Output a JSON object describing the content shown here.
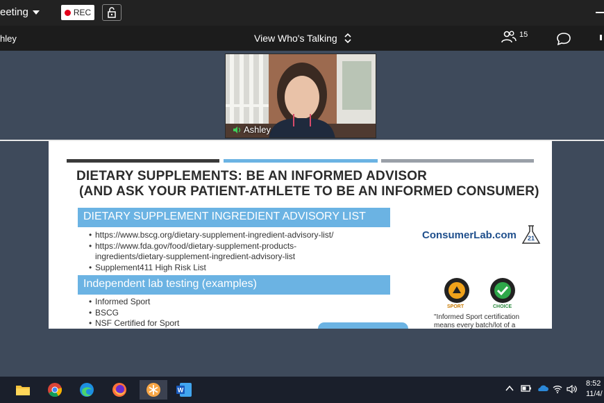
{
  "window": {
    "meeting_menu": "eeting",
    "rec_label": "REC"
  },
  "toolbar": {
    "speaker_name": "hley",
    "view_who_label": "View Who's Talking",
    "participant_count": "15"
  },
  "video": {
    "speaker_label": "Ashley"
  },
  "slide": {
    "title_line1": "DIETARY SUPPLEMENTS: BE AN INFORMED ADVISOR",
    "title_line2": "(AND ASK YOUR PATIENT-ATHLETE TO BE AN INFORMED CONSUMER)",
    "section1": {
      "heading": "DIETARY SUPPLEMENT INGREDIENT ADVISORY LIST",
      "bullets": [
        "https://www.bscg.org/dietary-supplement-ingredient-advisory-list/",
        "https://www.fda.gov/food/dietary-supplement-products-",
        "ingredients/dietary-supplement-ingredient-advisory-list",
        "Supplement411 High Risk List"
      ]
    },
    "section2": {
      "heading": "Independent lab testing (examples)",
      "bullets": [
        "Informed Sport",
        "BSCG",
        "NSF Certified for Sport"
      ]
    },
    "consumerlab_logo": "ConsumerLab.com",
    "years_badge": "21",
    "badge_sport": "SPORT",
    "badge_choice": "CHOICE",
    "cert_note_line1": "\"Informed Sport certification",
    "cert_note_line2": "means every batch/lot of a"
  },
  "taskbar": {
    "clock_time": "8:52",
    "clock_date": "11/4/"
  },
  "colors": {
    "accent_blue": "#6bb3e3",
    "rec_red": "#e3001b",
    "stripe_dark": "#3a3a3a",
    "stripe_grey": "#9aa0a8"
  }
}
